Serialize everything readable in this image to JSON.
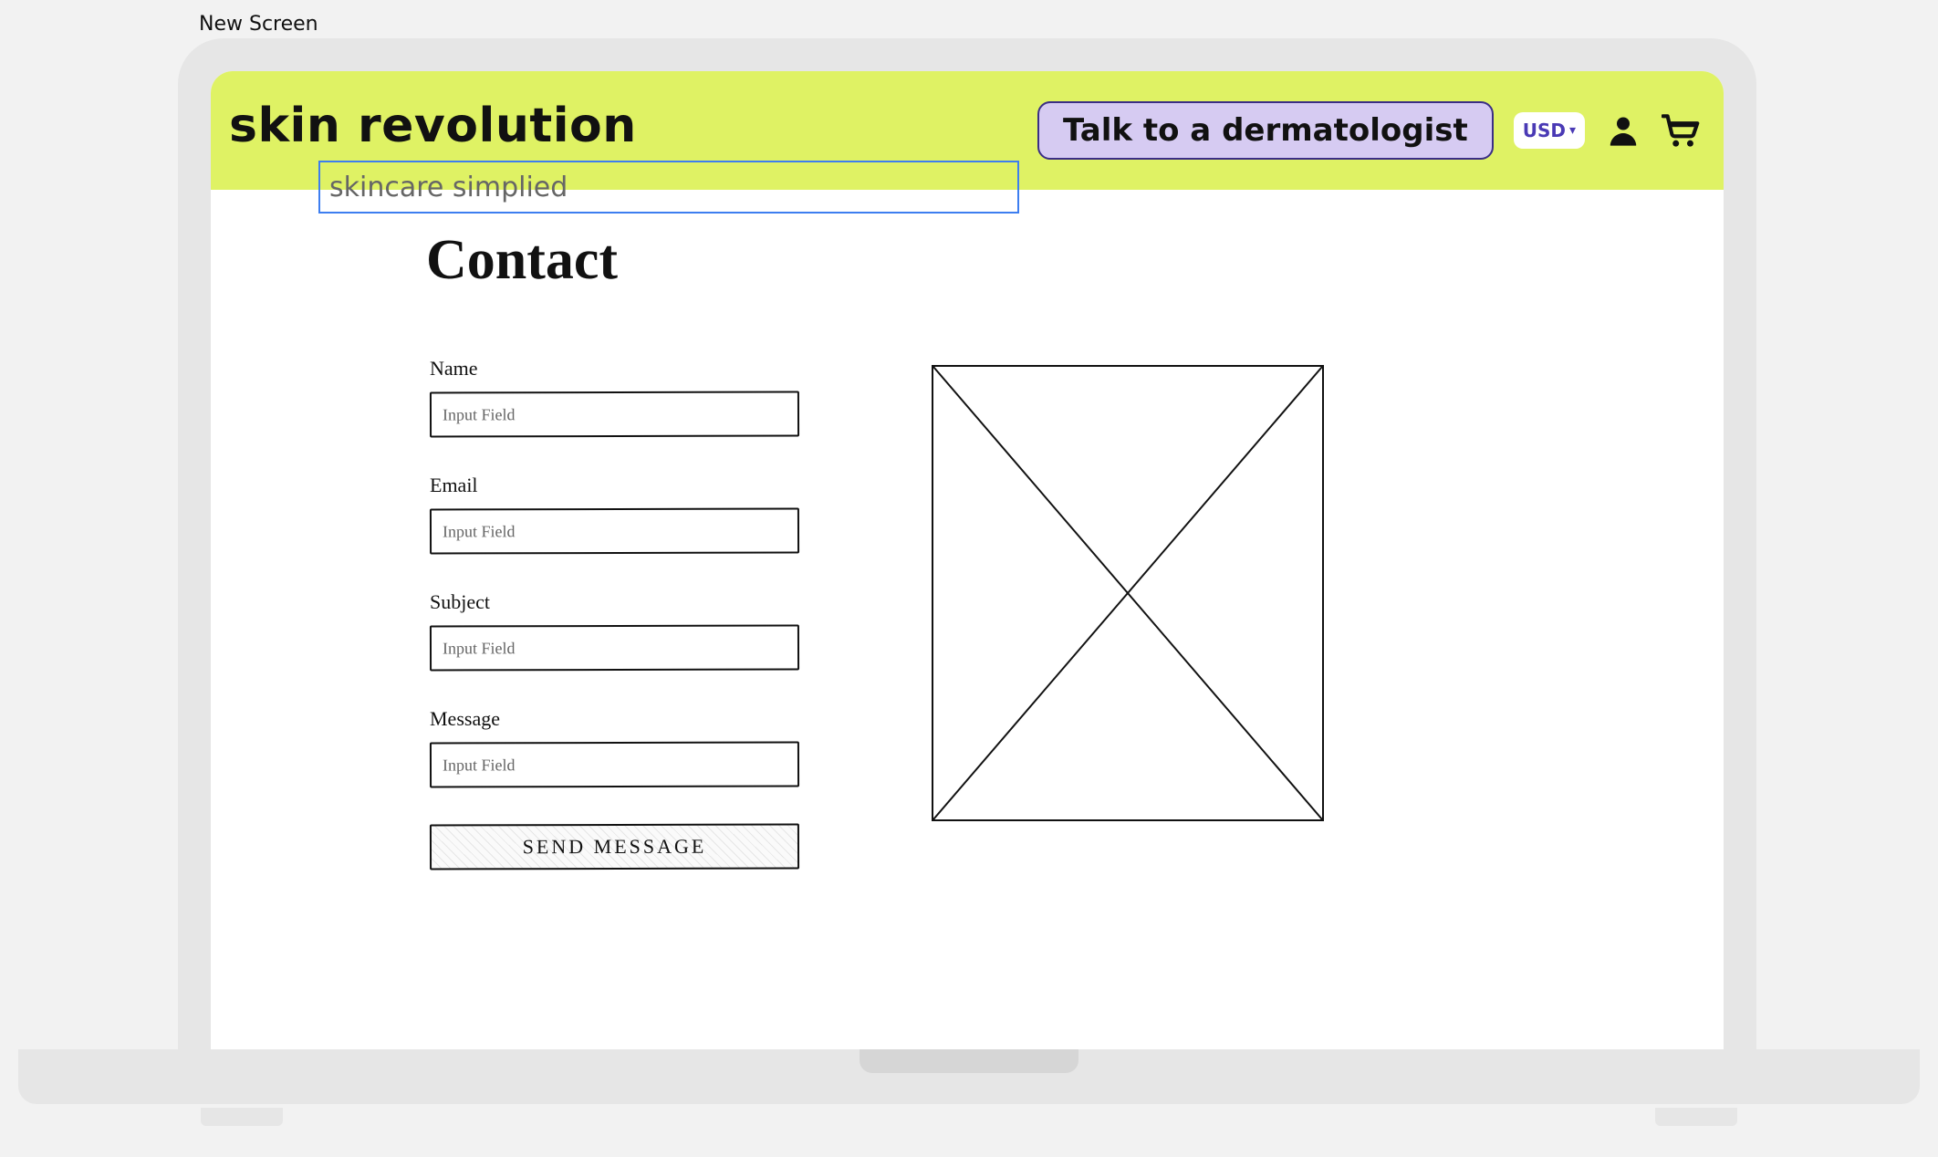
{
  "screen_label": "New Screen",
  "header": {
    "brand": "skin revolution",
    "tagline": "skincare simplied",
    "cta_label": "Talk to a dermatologist",
    "currency": "USD"
  },
  "page": {
    "title": "Contact"
  },
  "form": {
    "name": {
      "label": "Name",
      "placeholder": "Input Field"
    },
    "email": {
      "label": "Email",
      "placeholder": "Input Field"
    },
    "subject": {
      "label": "Subject",
      "placeholder": "Input Field"
    },
    "message": {
      "label": "Message",
      "placeholder": "Input Field"
    },
    "submit_label": "SEND MESSAGE"
  }
}
